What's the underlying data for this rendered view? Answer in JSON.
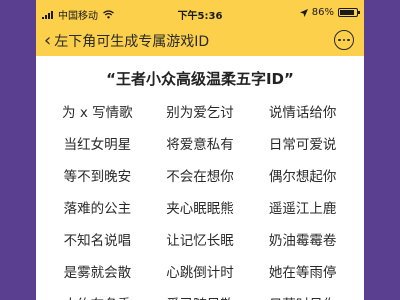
{
  "status_bar": {
    "carrier": "中国移动",
    "time": "下午5:36",
    "battery_percent": "86%",
    "battery_level": 0.86,
    "icons": [
      "signal-icon",
      "wifi-icon",
      "location-arrow-icon",
      "battery-icon"
    ]
  },
  "nav": {
    "back_label": "左下角可生成专属游戏ID",
    "more_icon": "more-dots-icon"
  },
  "main": {
    "title": "“王者小众高级温柔五字ID”",
    "names": [
      [
        "为 x 写情歌",
        "别为爱乞讨",
        "说情话给你"
      ],
      [
        "当红女明星",
        "将爱意私有",
        "日常可爱说"
      ],
      [
        "等不到晚安",
        "不会在想你",
        "偶尔想起你"
      ],
      [
        "落难的公主",
        "夹心眠眠熊",
        "遥遥江上鹿"
      ],
      [
        "不知名说唱",
        "让记忆长眠",
        "奶油霉霉卷"
      ],
      [
        "是雾就会散",
        "心跳倒计时",
        "她在等雨停"
      ],
      [
        "大约在冬季",
        "爱已随风散",
        "日落时见你"
      ]
    ]
  },
  "colors": {
    "accent": "#fcd04b",
    "background": "#5a3f91"
  }
}
